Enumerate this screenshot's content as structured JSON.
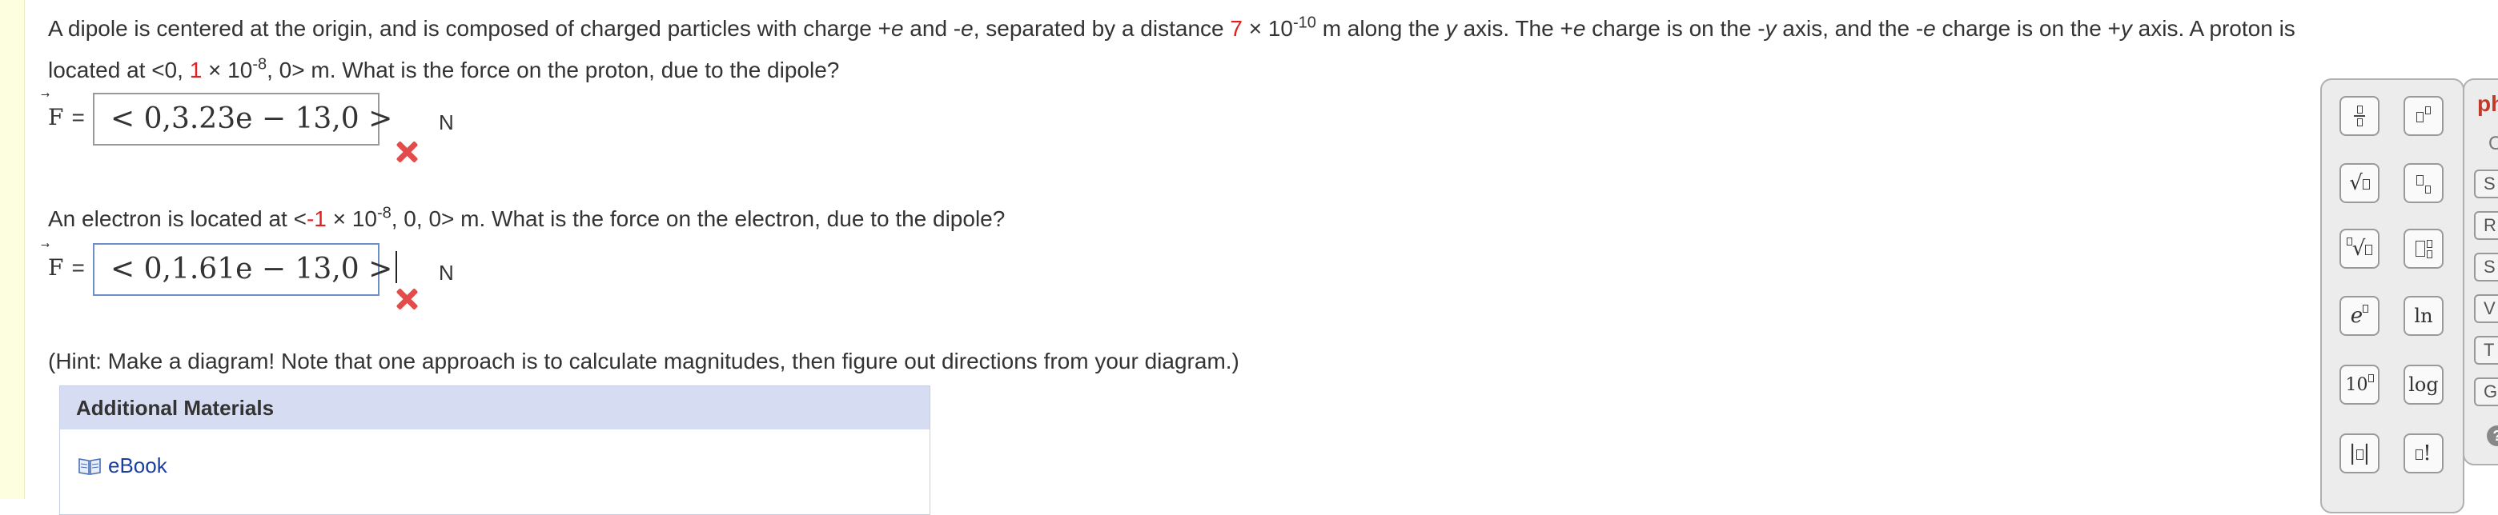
{
  "question1": {
    "seg1": "A dipole is centered at the origin, and is composed of charged particles with charge +",
    "e1": "e",
    "seg2": " and -",
    "e2": "e",
    "seg3": ", separated by a distance ",
    "distance_value": "7",
    "times": " × 10",
    "distance_exp": "-10",
    "seg4": " m along the ",
    "y1": "y",
    "seg5": " axis. The +",
    "e3": "e",
    "seg6": " charge is on the -",
    "y2": "y",
    "seg7": " axis, and the -",
    "e4": "e",
    "seg8": " charge is on the +",
    "y3": "y",
    "seg9": " axis. A proton is",
    "line2_a": "located at <0, ",
    "loc_value": "1",
    "line2_b": " × 10",
    "loc_exp": "-8",
    "line2_c": ", 0> m. What is the force on the proton, due to the dipole?"
  },
  "answer1": {
    "vector_symbol": "F",
    "equals": "=",
    "value": "< 0,3.23e − 13,0 >",
    "unit": "N",
    "status": "incorrect"
  },
  "question2": {
    "a": "An electron is located at <",
    "loc_value": "-1",
    "b": " × 10",
    "exp": "-8",
    "c": ", 0, 0> m. What is the force on the electron, due to the dipole?"
  },
  "answer2": {
    "vector_symbol": "F",
    "equals": "=",
    "value": "< 0,1.61e − 13,0 >",
    "unit": "N",
    "status": "incorrect"
  },
  "hint": "(Hint: Make a diagram! Note that one approach is to calculate magnitudes, then figure out directions from your diagram.)",
  "additional_materials": {
    "title": "Additional Materials",
    "ebook_label": "eBook",
    "ebook_icon": "book-icon"
  },
  "palette": {
    "buttons": [
      "fraction",
      "superscript",
      "sqrt",
      "subscript",
      "nth-root",
      "sub-superscript",
      "exp",
      "ln",
      "ten-power",
      "log",
      "abs",
      "factorial"
    ],
    "e_label": "e",
    "ln_label": "ln",
    "ten_label": "10",
    "log_label": "log",
    "factorial_label": "!"
  },
  "side_panel": {
    "title": "ph",
    "o_label": "O",
    "buttons": [
      "S",
      "R",
      "S",
      "V",
      "T",
      "G"
    ]
  },
  "colors": {
    "highlight_red": "#e02020",
    "error_x": "#e44b4b",
    "materials_header": "#d6dcf2",
    "link": "#1a3fa0",
    "left_stripe": "#fdfde0"
  }
}
